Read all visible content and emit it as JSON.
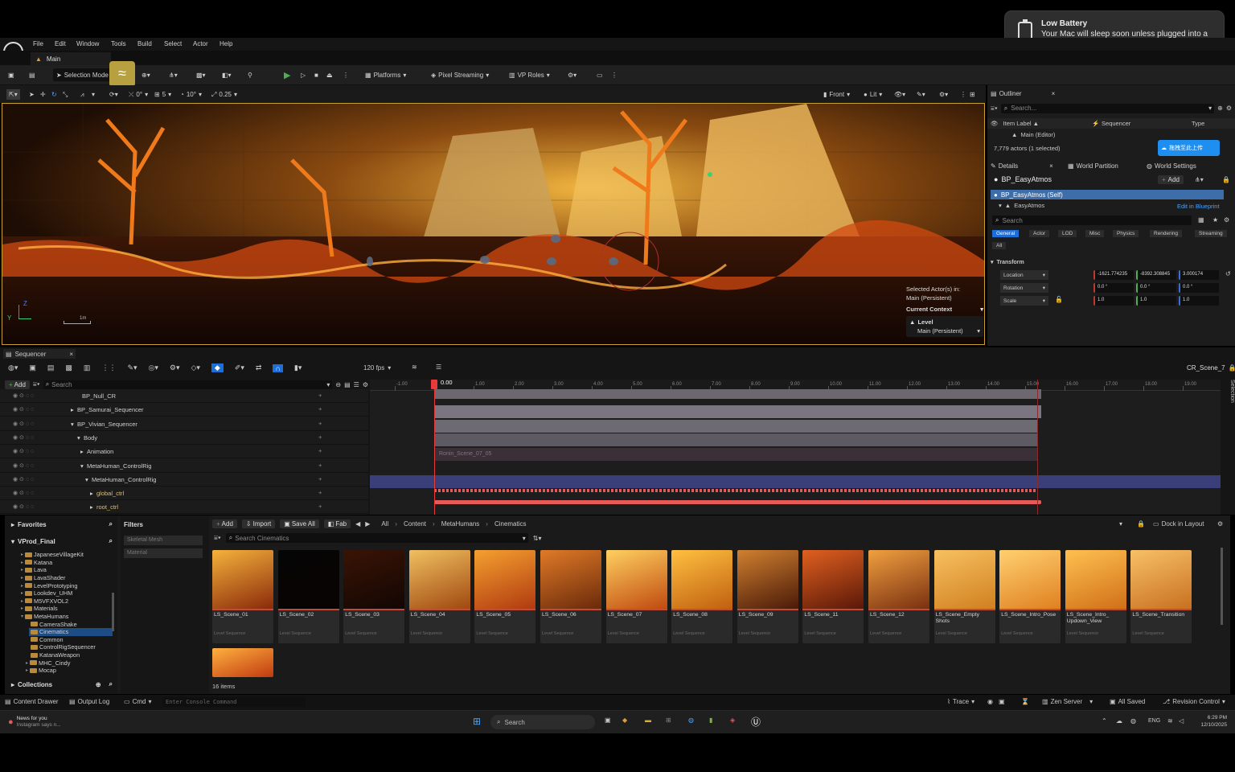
{
  "notification": {
    "title": "Low Battery",
    "body": "Your Mac will sleep soon unless plugged into a power outlet."
  },
  "menu": [
    "File",
    "Edit",
    "Window",
    "Tools",
    "Build",
    "Select",
    "Actor",
    "Help"
  ],
  "tab": {
    "label": "Main"
  },
  "toolbar": {
    "selection_mode": "Selection Mode",
    "platforms": "Platforms",
    "pixel_streaming": "Pixel Streaming",
    "vp_roles": "VP Roles"
  },
  "viewport_toolbar": {
    "angle": "0°",
    "grid": "5",
    "rot": "10°",
    "scale": "0.25",
    "view": "Front",
    "lit": "Lit"
  },
  "viewport": {
    "scale_label": "1m",
    "selected_actors": "Selected Actor(s) in:",
    "persistent": "Main (Persistent)",
    "current_context": "Current Context",
    "level": "Level",
    "level_value": "Main (Persistent)",
    "axis_z": "Z",
    "axis_y": "Y"
  },
  "outliner": {
    "title": "Outliner",
    "search": "Search...",
    "col_label": "Item Label",
    "col_sequencer": "Sequencer",
    "col_type": "Type",
    "item": "Main (Editor)",
    "count": "7,779 actors (1 selected)",
    "upload": "拖拽至此上传"
  },
  "details": {
    "tabs": [
      "Details",
      "World Partition",
      "World Settings"
    ],
    "actor": "BP_EasyAtmos",
    "add": "Add",
    "self": "BP_EasyAtmos (Self)",
    "component": "EasyAtmos",
    "edit_bp": "Edit in Blueprint",
    "search": "Search",
    "filters": [
      "General",
      "Actor",
      "LOD",
      "Misc",
      "Physics",
      "Rendering",
      "Streaming",
      "All"
    ],
    "section": "Transform",
    "props": [
      {
        "label": "Location",
        "v": [
          "-1621.774235",
          "-8392.308845",
          "3.000174"
        ]
      },
      {
        "label": "Rotation",
        "v": [
          "0.0 °",
          "0.0 °",
          "0.0 °"
        ]
      },
      {
        "label": "Scale",
        "v": [
          "1.0",
          "1.0",
          "1.0"
        ]
      }
    ]
  },
  "sequencer": {
    "title": "Sequencer",
    "fps": "120 fps",
    "add": "Add",
    "search": "Search",
    "scene": "CR_Scene_7",
    "time": "0.00",
    "side_tab": "Selection",
    "ticks": [
      "-1.00",
      "1.00",
      "2.00",
      "3.00",
      "4.00",
      "5.00",
      "6.00",
      "7.00",
      "8.00",
      "9.00",
      "10.00",
      "11.00",
      "12.00",
      "13.00",
      "14.00",
      "15.00",
      "16.00",
      "17.00",
      "18.00",
      "19.00"
    ],
    "tracks": [
      "BP_Null_CR",
      "BP_Samurai_Sequencer",
      "BP_Vivian_Sequencer",
      "Body",
      "Animation",
      "MetaHuman_ControlRig",
      "MetaHuman_ControlRig",
      "global_ctrl",
      "root_ctrl"
    ],
    "anim_clip": "Ronin_Scene_07_05"
  },
  "content_browser": {
    "favorites": "Favorites",
    "project": "VProd_Final",
    "filters": "Filters",
    "filter_items": [
      "Skeletal Mesh",
      "Material"
    ],
    "collections": "Collections",
    "add": "Add",
    "import": "Import",
    "save_all": "Save All",
    "fab": "Fab",
    "breadcrumb": [
      "All",
      "Content",
      "MetaHumans",
      "Cinematics"
    ],
    "dock": "Dock in Layout",
    "search": "Search Cinematics",
    "count": "16 items",
    "folders": [
      "JapaneseVillageKit",
      "Katana",
      "Lava",
      "LavaShader",
      "LevelPrototyping",
      "Lookdev_UHM",
      "M5VFXVOL2",
      "Materials",
      "MetaHumans",
      "CameraShake",
      "Cinematics",
      "Common",
      "ControlRigSequencer",
      "KatanaWeapon",
      "MHC_Cindy",
      "Mocap"
    ],
    "assets": [
      "LS_Scene_01",
      "LS_Scene_02",
      "LS_Scene_03",
      "LS_Scene_04",
      "LS_Scene_05",
      "LS_Scene_06",
      "LS_Scene_07",
      "LS_Scene_08",
      "LS_Scene_09",
      "LS_Scene_11",
      "LS_Scene_12",
      "LS_Scene_Empty Shots",
      "LS_Scene_Intro_Pose",
      "LS_Scene_Intro_ Updown_View",
      "LS_Scene_Transition",
      ""
    ],
    "asset_type": "Level Sequence"
  },
  "statusbar": {
    "drawer": "Content Drawer",
    "output": "Output Log",
    "cmd": "Cmd",
    "console": "Enter Console Command",
    "trace": "Trace",
    "zen": "Zen Server",
    "saved": "All Saved",
    "rc": "Revision Control"
  },
  "taskbar": {
    "news": "News for you",
    "news_sub": "Instagram says n...",
    "search": "Search",
    "lang": "ENG",
    "time": "6:29 PM",
    "date": "12/10/2025"
  }
}
